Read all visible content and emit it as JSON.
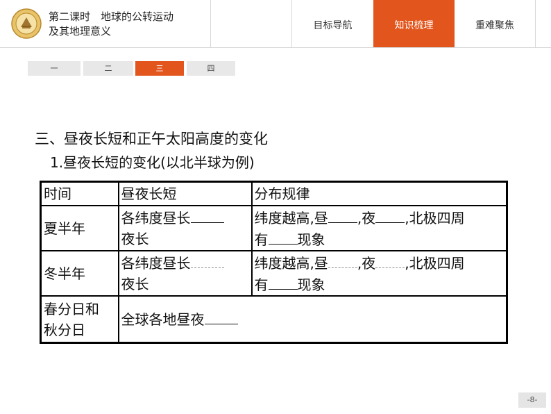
{
  "header": {
    "title_line1": "第二课时　地球的公转运动",
    "title_line2": "及其地理意义",
    "nav": [
      "目标导航",
      "知识梳理",
      "重难聚焦"
    ],
    "active_nav": 1
  },
  "subtabs": [
    "一",
    "二",
    "三",
    "四"
  ],
  "active_subtab": 2,
  "section": {
    "heading": "三、昼夜长短和正午太阳高度的变化",
    "subheading": "1.昼夜长短的变化(以北半球为例)"
  },
  "table": {
    "headers": [
      "时间",
      "昼夜长短",
      "分布规律"
    ],
    "rows": [
      {
        "time": "夏半年",
        "length_a": "各纬度昼长",
        "length_b": "夜长",
        "rule_a": "纬度越高,昼",
        "rule_b": ",夜",
        "rule_c": ",北极四周",
        "rule_d": "有",
        "rule_e": "现象"
      },
      {
        "time": "冬半年",
        "length_a": "各纬度昼长",
        "length_b": "夜长",
        "rule_a": "纬度越高,昼",
        "rule_b": ",夜",
        "rule_c": ",北极四周",
        "rule_d": "有",
        "rule_e": "现象"
      },
      {
        "time_a": "春分日和",
        "time_b": "秋分日",
        "content": "全球各地昼夜"
      }
    ]
  },
  "page_number": "-8-",
  "colors": {
    "accent": "#e2561d",
    "tab_bg": "#e8e8e8"
  }
}
